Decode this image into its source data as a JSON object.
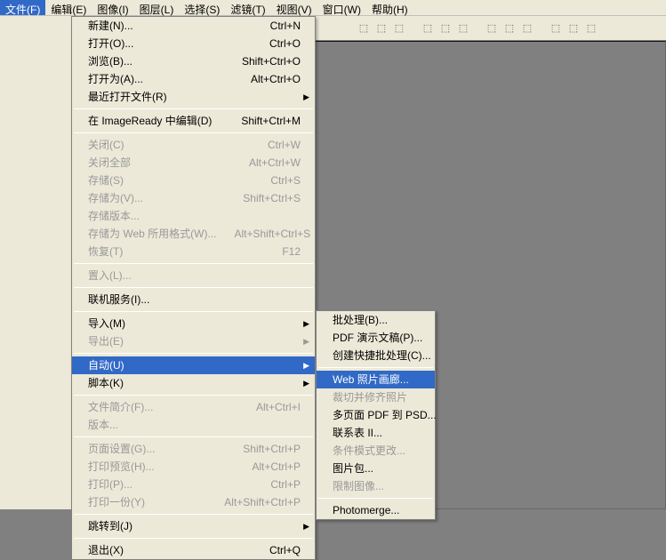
{
  "menubar": {
    "items": [
      {
        "label": "文件(F)"
      },
      {
        "label": "编辑(E)"
      },
      {
        "label": "图像(I)"
      },
      {
        "label": "图层(L)"
      },
      {
        "label": "选择(S)"
      },
      {
        "label": "滤镜(T)"
      },
      {
        "label": "视图(V)"
      },
      {
        "label": "窗口(W)"
      },
      {
        "label": "帮助(H)"
      }
    ],
    "active_index": 0
  },
  "file_menu": {
    "groups": [
      [
        {
          "label": "新建(N)...",
          "shortcut": "Ctrl+N"
        },
        {
          "label": "打开(O)...",
          "shortcut": "Ctrl+O"
        },
        {
          "label": "浏览(B)...",
          "shortcut": "Shift+Ctrl+O"
        },
        {
          "label": "打开为(A)...",
          "shortcut": "Alt+Ctrl+O"
        },
        {
          "label": "最近打开文件(R)",
          "shortcut": "",
          "arrow": true
        }
      ],
      [
        {
          "label": "在 ImageReady 中编辑(D)",
          "shortcut": "Shift+Ctrl+M"
        }
      ],
      [
        {
          "label": "关闭(C)",
          "shortcut": "Ctrl+W",
          "disabled": true
        },
        {
          "label": "关闭全部",
          "shortcut": "Alt+Ctrl+W",
          "disabled": true
        },
        {
          "label": "存储(S)",
          "shortcut": "Ctrl+S",
          "disabled": true
        },
        {
          "label": "存储为(V)...",
          "shortcut": "Shift+Ctrl+S",
          "disabled": true
        },
        {
          "label": "存储版本...",
          "shortcut": "",
          "disabled": true
        },
        {
          "label": "存储为 Web 所用格式(W)...",
          "shortcut": "Alt+Shift+Ctrl+S",
          "disabled": true
        },
        {
          "label": "恢复(T)",
          "shortcut": "F12",
          "disabled": true
        }
      ],
      [
        {
          "label": "置入(L)...",
          "shortcut": "",
          "disabled": true
        }
      ],
      [
        {
          "label": "联机服务(I)...",
          "shortcut": ""
        }
      ],
      [
        {
          "label": "导入(M)",
          "shortcut": "",
          "arrow": true
        },
        {
          "label": "导出(E)",
          "shortcut": "",
          "arrow": true,
          "disabled": true
        }
      ],
      [
        {
          "label": "自动(U)",
          "shortcut": "",
          "arrow": true,
          "highlighted": true
        },
        {
          "label": "脚本(K)",
          "shortcut": "",
          "arrow": true
        }
      ],
      [
        {
          "label": "文件简介(F)...",
          "shortcut": "Alt+Ctrl+I",
          "disabled": true
        },
        {
          "label": "版本...",
          "shortcut": "",
          "disabled": true
        }
      ],
      [
        {
          "label": "页面设置(G)...",
          "shortcut": "Shift+Ctrl+P",
          "disabled": true
        },
        {
          "label": "打印预览(H)...",
          "shortcut": "Alt+Ctrl+P",
          "disabled": true
        },
        {
          "label": "打印(P)...",
          "shortcut": "Ctrl+P",
          "disabled": true
        },
        {
          "label": "打印一份(Y)",
          "shortcut": "Alt+Shift+Ctrl+P",
          "disabled": true
        }
      ],
      [
        {
          "label": "跳转到(J)",
          "shortcut": "",
          "arrow": true
        }
      ],
      [
        {
          "label": "退出(X)",
          "shortcut": "Ctrl+Q"
        }
      ]
    ]
  },
  "auto_submenu": {
    "groups": [
      [
        {
          "label": "批处理(B)..."
        },
        {
          "label": "PDF 演示文稿(P)..."
        },
        {
          "label": "创建快捷批处理(C)..."
        }
      ],
      [
        {
          "label": "Web 照片画廊...",
          "highlighted": true
        },
        {
          "label": "裁切并修齐照片",
          "disabled": true
        },
        {
          "label": "多页面 PDF 到 PSD..."
        },
        {
          "label": "联系表 II..."
        },
        {
          "label": "条件模式更改...",
          "disabled": true
        },
        {
          "label": "图片包..."
        },
        {
          "label": "限制图像...",
          "disabled": true
        }
      ],
      [
        {
          "label": "Photomerge..."
        }
      ]
    ]
  }
}
